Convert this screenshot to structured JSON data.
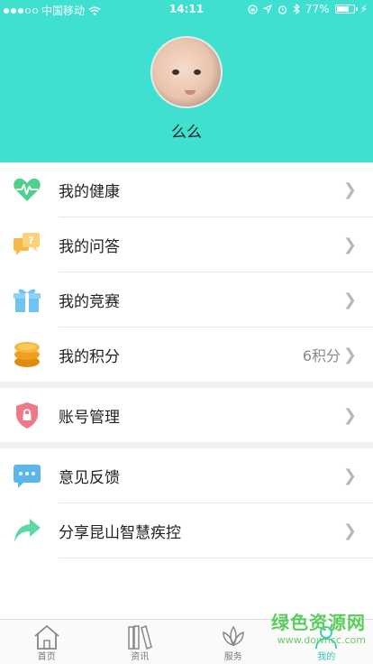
{
  "status_bar": {
    "carrier": "中国移动",
    "time": "14:11",
    "battery_percent": "77%",
    "battery_level": 0.77,
    "icons": [
      "signal-dots-icon",
      "wifi-icon",
      "lock-rotation-icon",
      "location-icon",
      "alarm-icon",
      "bluetooth-icon",
      "battery-icon",
      "charging-icon"
    ]
  },
  "profile": {
    "name": "么么",
    "header_color": "#40e0d0"
  },
  "menu": {
    "health": {
      "label": "我的健康",
      "icon": "heart-pulse-icon",
      "color": "#4fd08d"
    },
    "qa": {
      "label": "我的问答",
      "icon": "chat-question-icon",
      "color": "#f5c35a"
    },
    "contest": {
      "label": "我的竞赛",
      "icon": "gift-icon",
      "color": "#6ec3f0"
    },
    "points": {
      "label": "我的积分",
      "value": "6积分",
      "icon": "coins-icon",
      "color": "#f0a020"
    },
    "account": {
      "label": "账号管理",
      "icon": "shield-lock-icon",
      "color": "#ef7a86"
    },
    "feedback": {
      "label": "意见反馈",
      "icon": "message-dots-icon",
      "color": "#5ab7ea"
    },
    "share": {
      "label": "分享昆山智慧疾控",
      "icon": "share-arrow-icon",
      "color": "#5fd6a5"
    }
  },
  "tabs": [
    {
      "label": "首页",
      "icon": "home-icon",
      "active": false
    },
    {
      "label": "资讯",
      "icon": "books-icon",
      "active": false
    },
    {
      "label": "服务",
      "icon": "lotus-icon",
      "active": false
    },
    {
      "label": "我的",
      "icon": "person-icon",
      "active": true
    }
  ],
  "watermark": {
    "title": "绿色资源网",
    "url": "www.downcc.com"
  }
}
